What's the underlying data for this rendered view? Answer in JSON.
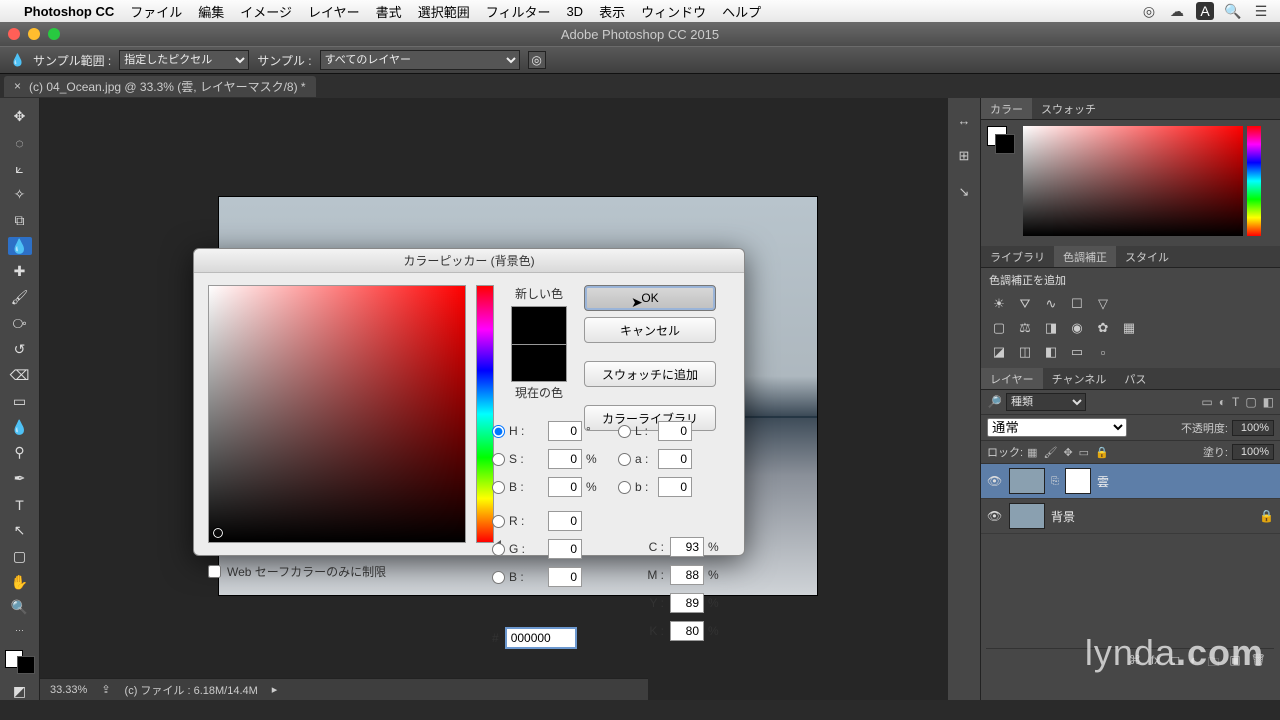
{
  "menubar": {
    "app": "Photoshop CC",
    "items": [
      "ファイル",
      "編集",
      "イメージ",
      "レイヤー",
      "書式",
      "選択範囲",
      "フィルター",
      "3D",
      "表示",
      "ウィンドウ",
      "ヘルプ"
    ]
  },
  "window": {
    "title": "Adobe Photoshop CC 2015"
  },
  "options": {
    "sample_range_label": "サンプル範囲 :",
    "sample_range_value": "指定したピクセル",
    "sample_label": "サンプル :",
    "sample_value": "すべてのレイヤー"
  },
  "doc_tab": {
    "name": "(c) 04_Ocean.jpg @ 33.3% (雲, レイヤーマスク/8) *"
  },
  "panels": {
    "color_tabs": [
      "カラー",
      "スウォッチ"
    ],
    "adjust_tabs": [
      "ライブラリ",
      "色調補正",
      "スタイル"
    ],
    "adjust_head": "色調補正を追加",
    "layer_tabs": [
      "レイヤー",
      "チャンネル",
      "パス"
    ],
    "filter_label": "種類",
    "blend_value": "通常",
    "opacity_label": "不透明度:",
    "opacity_value": "100%",
    "lock_label": "ロック:",
    "fill_label": "塗り:",
    "fill_value": "100%",
    "layers": [
      {
        "name": "雲",
        "selected": true,
        "mask": true,
        "locked": false
      },
      {
        "name": "背景",
        "selected": false,
        "mask": false,
        "locked": true
      }
    ]
  },
  "status": {
    "zoom": "33.33%",
    "info": "(c) ファイル : 6.18M/14.4M"
  },
  "watermark": "lynda.com",
  "dialog": {
    "title": "カラーピッカー (背景色)",
    "new_label": "新しい色",
    "current_label": "現在の色",
    "btn_ok": "OK",
    "btn_cancel": "キャンセル",
    "btn_addswatch": "スウォッチに追加",
    "btn_library": "カラーライブラリ",
    "webonly": "Web セーフカラーのみに制限",
    "H": "0",
    "S": "0",
    "Bv": "0",
    "R": "0",
    "G": "0",
    "B": "0",
    "L": "0",
    "a": "0",
    "b": "0",
    "C": "93",
    "M": "88",
    "Y": "89",
    "K": "80",
    "hex": "000000"
  }
}
